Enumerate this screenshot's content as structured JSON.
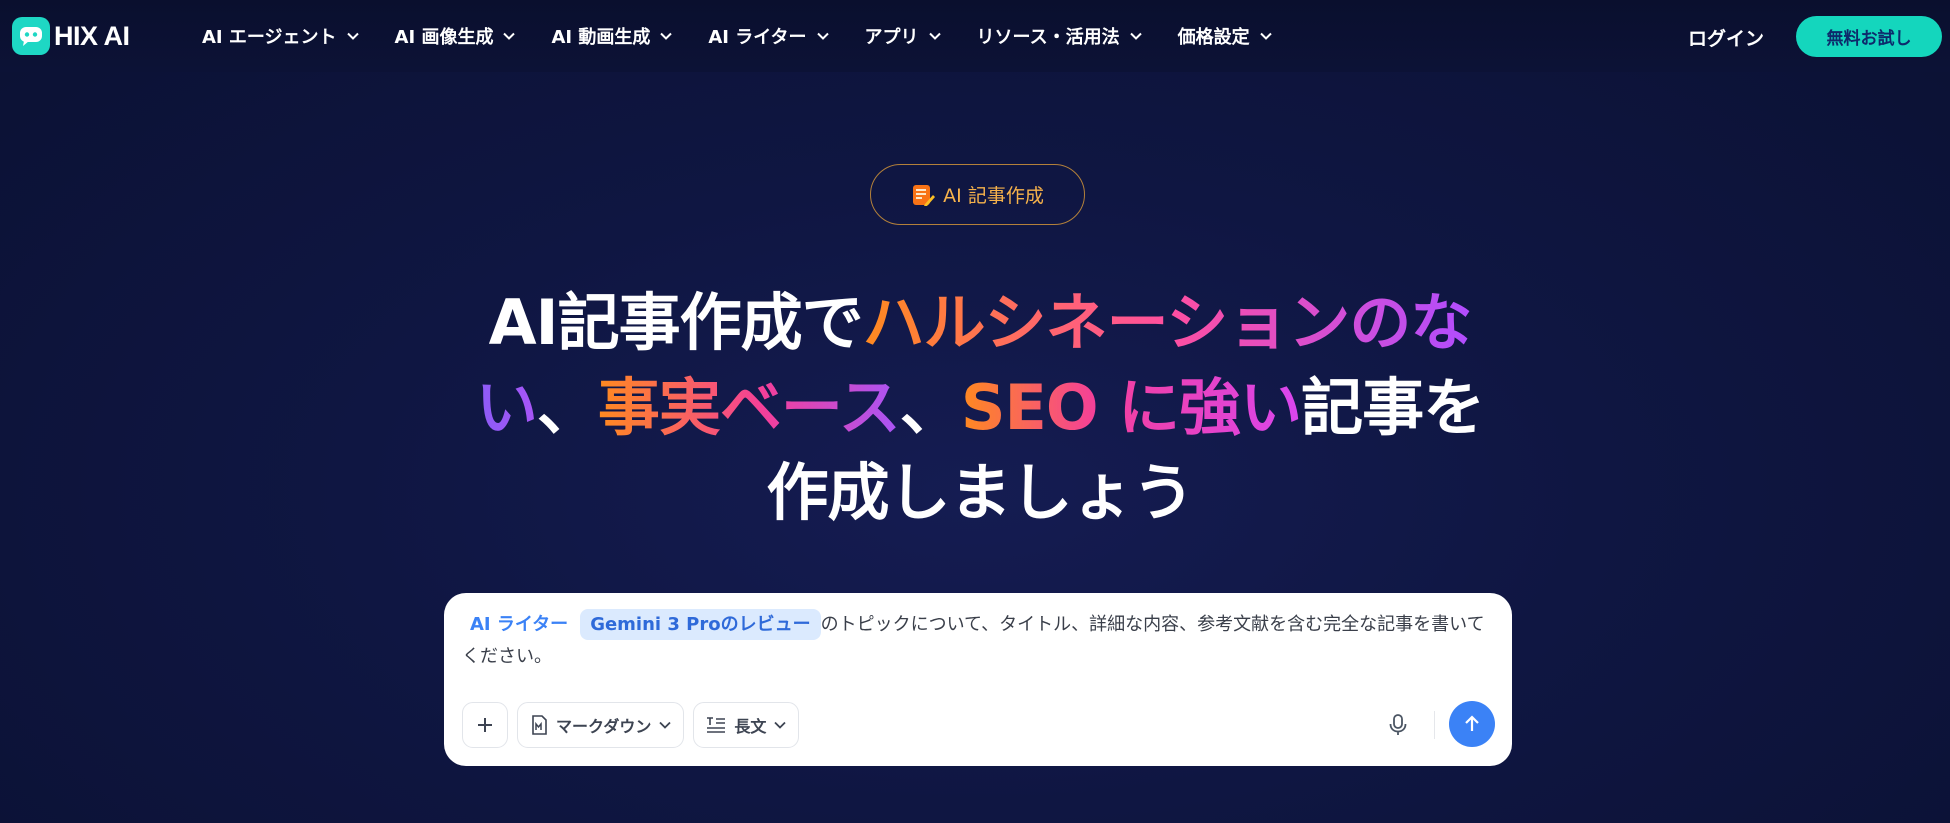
{
  "brand": {
    "name": "HIX AI",
    "accent": "#1ed7c4"
  },
  "nav": {
    "items": [
      {
        "label": "AI エージェント"
      },
      {
        "label": "AI 画像生成"
      },
      {
        "label": "AI 動画生成"
      },
      {
        "label": "AI ライター"
      },
      {
        "label": "アプリ"
      },
      {
        "label": "リソース・活用法"
      },
      {
        "label": "価格設定"
      }
    ],
    "login_label": "ログイン",
    "trial_label": "無料お試し"
  },
  "hero": {
    "badge_label": "AI 記事作成",
    "headline": {
      "l1_a": "AI記事作成で",
      "l1_b": "ハルシネーションのな",
      "l2_a": "い",
      "l2_b": "、",
      "l2_c": "事実ベース",
      "l2_d": "、",
      "l2_e": "SEO に強い",
      "l2_f": "記事を",
      "l3": "作成しましょう"
    }
  },
  "composer": {
    "writer_chip": "AI ライター",
    "topic_chip": "Gemini 3 Proのレビュー",
    "prompt_text": "のトピックについて、タイトル、詳細な内容、参考文献を含む完全な記事を書いてください。",
    "format_label": "マークダウン",
    "length_label": "長文",
    "send_color": "#3b82f6"
  }
}
